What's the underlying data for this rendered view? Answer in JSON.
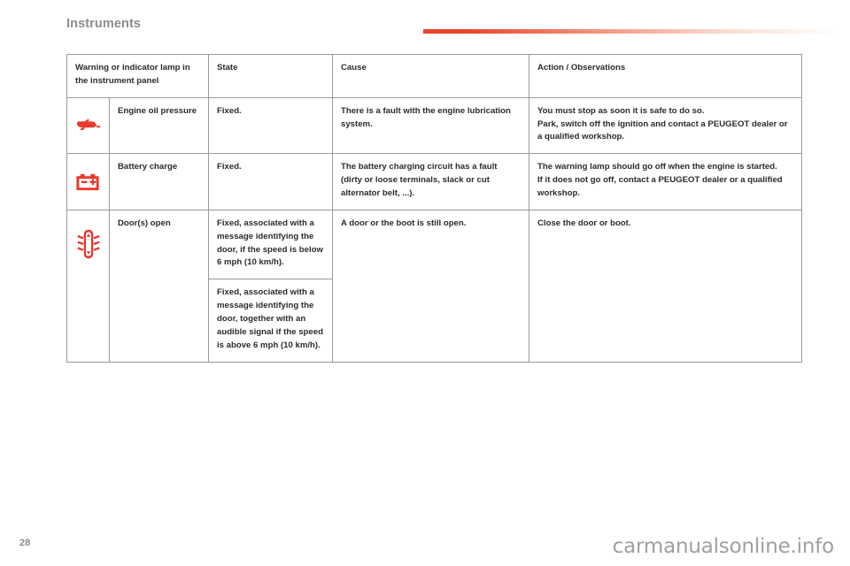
{
  "header": {
    "section_title": "Instruments",
    "rule_color": "#e8452c"
  },
  "table": {
    "columns": [
      {
        "id": "lamp",
        "label": "Warning or indicator lamp in the instrument panel"
      },
      {
        "id": "state",
        "label": "State"
      },
      {
        "id": "cause",
        "label": "Cause"
      },
      {
        "id": "action",
        "label": "Action / Observations"
      }
    ],
    "rows": [
      {
        "icon": "engine-oil-pressure-icon",
        "icon_color": "#e8372c",
        "name": "Engine oil pressure",
        "states": [
          "Fixed."
        ],
        "cause": "There is a fault with the engine lubrication system.",
        "action_lines": [
          "You must stop as soon it is safe to do so.",
          "Park, switch off the ignition and contact a PEUGEOT dealer or a qualified workshop."
        ]
      },
      {
        "icon": "battery-charge-icon",
        "icon_color": "#e8372c",
        "name": "Battery charge",
        "states": [
          "Fixed."
        ],
        "cause": "The battery charging circuit has a fault (dirty or loose terminals, slack or cut alternator belt, ...).",
        "action_lines": [
          "The warning lamp should go off when the engine is started.",
          "If it does not go off, contact a PEUGEOT dealer or a qualified workshop."
        ]
      },
      {
        "icon": "doors-open-icon",
        "icon_color": "#e8372c",
        "name": "Door(s) open",
        "states": [
          "Fixed, associated with a message identifying the door, if the speed is below 6 mph (10 km/h).",
          "Fixed, associated with a message identifying the door, together with an audible signal if the speed is above 6 mph (10 km/h)."
        ],
        "cause": "A door or the boot is still open.",
        "action_lines": [
          "Close the door or boot."
        ]
      }
    ]
  },
  "footer": {
    "page_number": "28",
    "watermark": "carmanualsonline.info"
  }
}
